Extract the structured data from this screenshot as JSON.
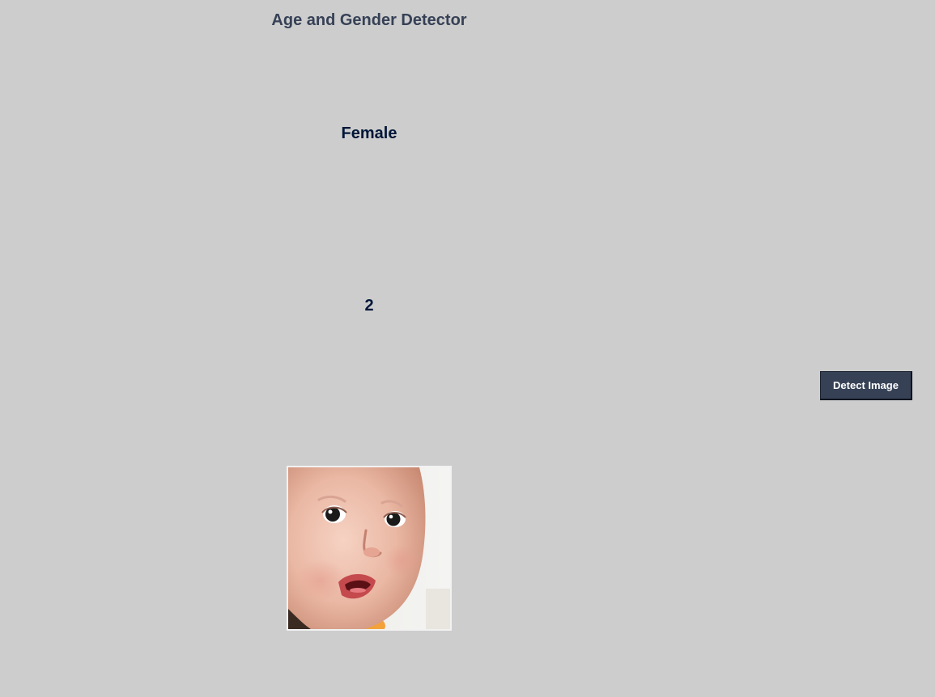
{
  "app": {
    "title": "Age and Gender Detector"
  },
  "results": {
    "gender": "Female",
    "age": "2"
  },
  "actions": {
    "detect_label": "Detect Image"
  },
  "colors": {
    "background": "#cdcdcd",
    "title": "#364156",
    "result_text": "#011638",
    "button_bg": "#364156",
    "button_text": "#ffffff"
  },
  "image": {
    "subject": "uploaded-face-photo"
  }
}
